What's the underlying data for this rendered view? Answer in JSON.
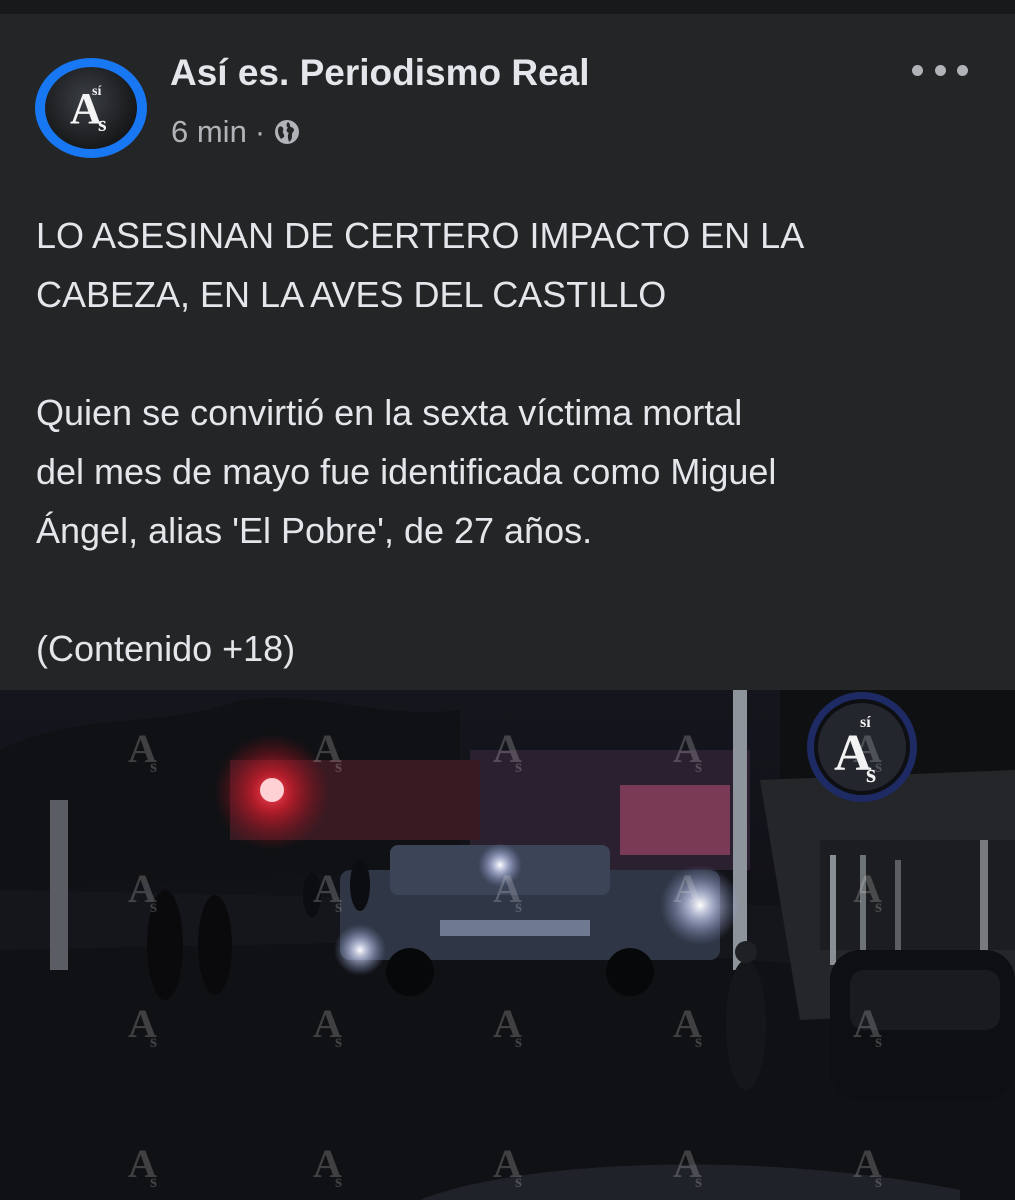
{
  "post": {
    "author": "Así es. Periodismo Real",
    "time": "6 min",
    "separator": "·",
    "audience_icon": "globe-icon",
    "more_icon": "more-options-icon",
    "headline_lines": [
      "LO ASESINAN DE CERTERO IMPACTO EN LA",
      "CABEZA, EN LA AVES DEL CASTILLO"
    ],
    "body_lines": [
      "Quien se convirtió en la sexta víctima mortal",
      "del mes de mayo fue identificada como Miguel",
      "Ángel, alias 'El Pobre', de 27 años."
    ],
    "warning": "(Contenido +18)"
  },
  "logo": {
    "main": "A",
    "top": "sí",
    "bottom": "s"
  },
  "colors": {
    "background": "#242526",
    "text": "#e4e6eb",
    "secondary_text": "#b0b3b8",
    "avatar_ring": "#1877f2"
  }
}
